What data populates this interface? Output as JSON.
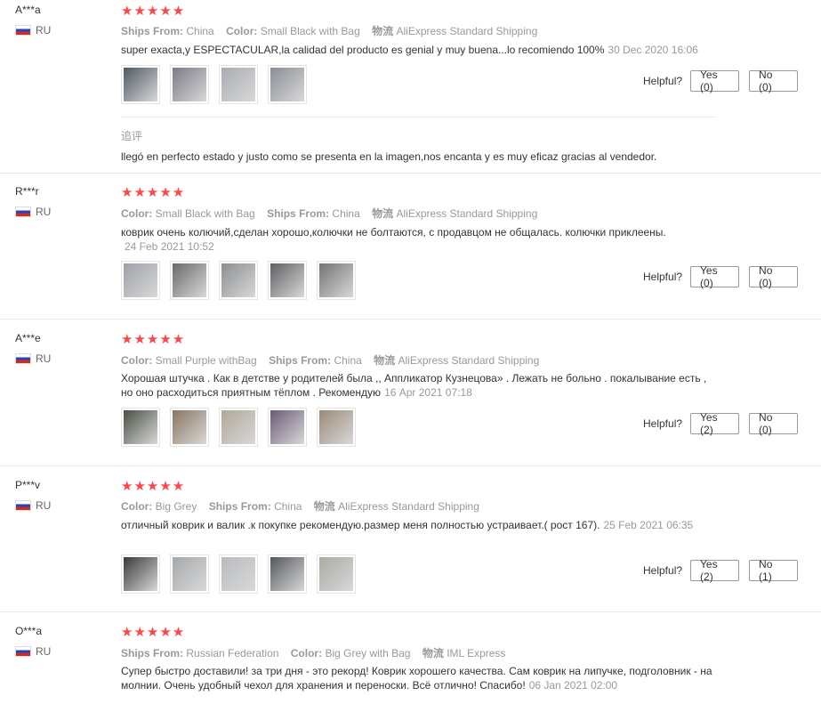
{
  "helpful_label": "Helpful?",
  "labels": {
    "ships_from": "Ships From:",
    "color": "Color:",
    "shipping": "物流"
  },
  "reviews": [
    {
      "user": "A***a",
      "country": "RU",
      "stars": "★★★★★",
      "ships_from": "China",
      "color": "Small Black with Bag",
      "shipping": "AliExpress Standard Shipping",
      "content": "super exacta,y ESPECTACULAR,la calidad del producto es genial y muy buena...lo recomiendo 100%",
      "date": "30 Dec 2020 16:06",
      "yes": "Yes (0)",
      "no": "No (0)",
      "followup_label": "追评",
      "followup_text": "llegó en perfecto estado y justo como se presenta en la imagen,nos encanta y es muy eficaz gracias al vendedor.",
      "thumb_colors": [
        "#4f5a63",
        "#7c7a86",
        "#a9acb2",
        "#8a8e96"
      ]
    },
    {
      "user": "R***r",
      "country": "RU",
      "stars": "★★★★★",
      "color": "Small Black with Bag",
      "ships_from": "China",
      "shipping": "AliExpress Standard Shipping",
      "content": "коврик очень колючий,сделан хорошо,колючки не болтаются, с продавцом не общалась. колючки приклеены.",
      "date": "24 Feb 2021 10:52",
      "yes": "Yes (0)",
      "no": "No (0)",
      "thumb_colors": [
        "#9ea2a8",
        "#6b6a6a",
        "#8c8e91",
        "#5f6063",
        "#747474"
      ]
    },
    {
      "user": "A***e",
      "country": "RU",
      "stars": "★★★★★",
      "color": "Small Purple withBag",
      "ships_from": "China",
      "shipping": "AliExpress Standard Shipping",
      "content": "Хорошая штучка . Как в детстве у родителей была ,, Аппликатор Кузнецова» . Лежать не больно . покалывание есть , но оно расходиться приятным тёплом . Рекомендую",
      "date": "16 Apr 2021 07:18",
      "yes": "Yes (2)",
      "no": "No (0)",
      "thumb_colors": [
        "#4a5045",
        "#8a7560",
        "#b0a898",
        "#6b5a78",
        "#9a8a78"
      ]
    },
    {
      "user": "P***v",
      "country": "RU",
      "stars": "★★★★★",
      "color": "Big Grey",
      "ships_from": "China",
      "shipping": "AliExpress Standard Shipping",
      "content": "отличный коврик и валик .к покупке рекомендую.размер меня полностью устраивает.( рост 167).",
      "date": "25 Feb 2021 06:35",
      "yes": "Yes (2)",
      "no": "No (1)",
      "thumb_colors": [
        "#3a3a3c",
        "#a5a8ab",
        "#b8bbbe",
        "#55585c",
        "#a9aba3"
      ]
    },
    {
      "user": "O***a",
      "country": "RU",
      "stars": "★★★★★",
      "ships_from": "Russian Federation",
      "color": "Big Grey with Bag",
      "shipping": "IML Express",
      "content": "Супер быстро доставили! за три дня - это рекорд! Коврик хорошего качества. Сам коврик на липучке, подголовник - на молнии. Очень удобный чехол для хранения и переноски. Всё отлично! Спасибо!",
      "date": "06 Jan 2021 02:00"
    }
  ]
}
